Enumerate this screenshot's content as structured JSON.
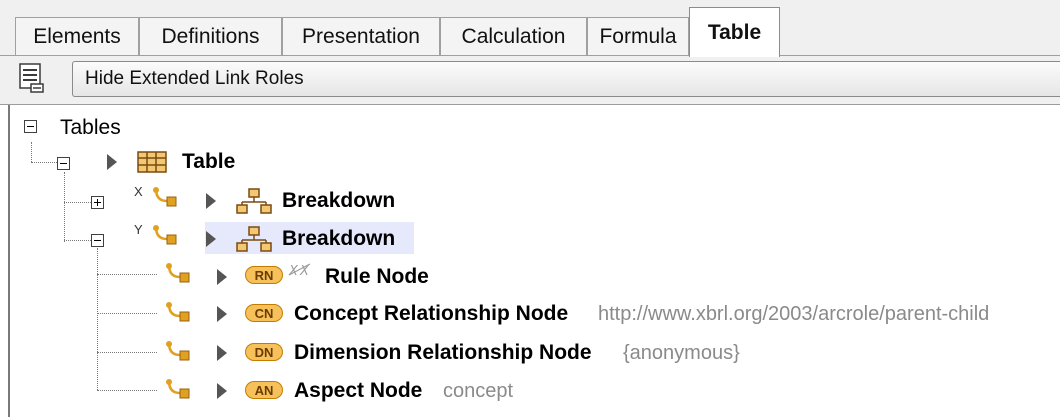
{
  "tabs": [
    {
      "label": "Elements"
    },
    {
      "label": "Definitions"
    },
    {
      "label": "Presentation"
    },
    {
      "label": "Calculation"
    },
    {
      "label": "Formula"
    },
    {
      "label": "Table",
      "active": true
    }
  ],
  "toolbar": {
    "icon": "roles-list-icon",
    "button_label": "Hide Extended Link Roles"
  },
  "tree": {
    "root_label": "Tables",
    "table_label": "Table",
    "breakdown_x": {
      "axis": "X",
      "label": "Breakdown"
    },
    "breakdown_y": {
      "axis": "Y",
      "label": "Breakdown"
    },
    "nodes": [
      {
        "badge": "RN",
        "label": "Rule Node",
        "detail": ""
      },
      {
        "badge": "CN",
        "label": "Concept Relationship Node",
        "detail": "http://www.xbrl.org/2003/arcrole/parent-child"
      },
      {
        "badge": "DN",
        "label": "Dimension Relationship Node",
        "detail": "{anonymous}"
      },
      {
        "badge": "AN",
        "label": "Aspect Node",
        "detail": "concept"
      }
    ]
  },
  "colors": {
    "badge_fill": "#f6c15a",
    "selection": "#e6e8fb",
    "detail_text": "#8a8a8a"
  }
}
